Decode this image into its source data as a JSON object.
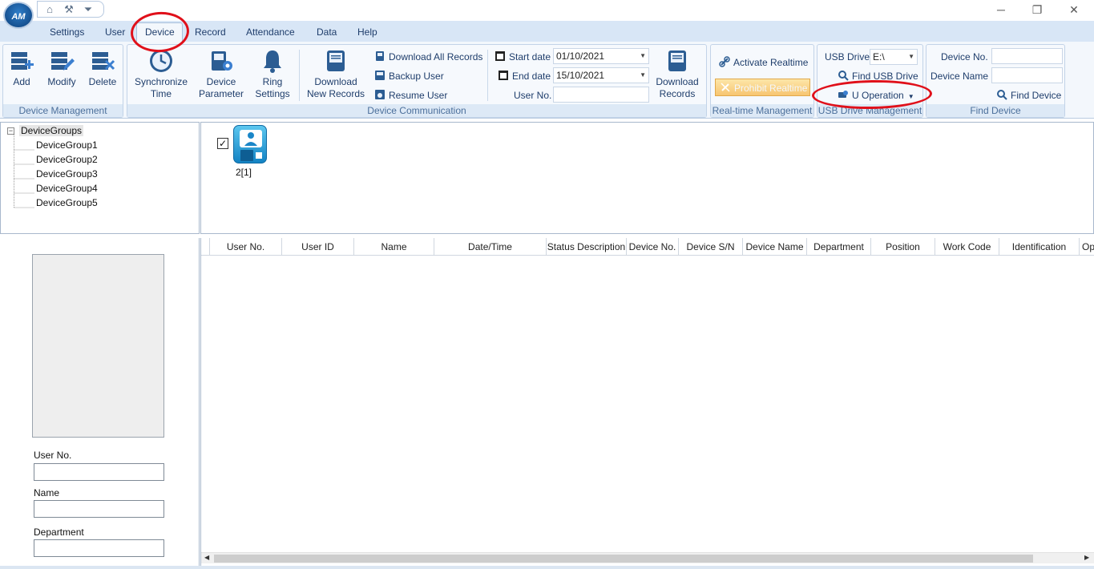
{
  "window": {
    "minimize": "─",
    "restore": "❐",
    "close": "✕"
  },
  "logo_text": "AM",
  "menu": {
    "tabs": [
      "Settings",
      "User",
      "Device",
      "Record",
      "Attendance",
      "Data",
      "Help"
    ],
    "active": "Device"
  },
  "ribbon": {
    "device_management": {
      "caption": "Device Management",
      "add": "Add",
      "modify": "Modify",
      "delete": "Delete"
    },
    "device_communication": {
      "caption": "Device Communication",
      "sync_time": [
        "Synchronize",
        "Time"
      ],
      "device_parameter": [
        "Device",
        "Parameter"
      ],
      "ring_settings": [
        "Ring",
        "Settings"
      ],
      "download_new_records": [
        "Download",
        "New Records"
      ],
      "download_all_records": "Download All Records",
      "backup_user": "Backup User",
      "resume_user": "Resume User",
      "start_date_label": "Start date",
      "start_date_value": "01/10/2021",
      "end_date_label": "End date",
      "end_date_value": "15/10/2021",
      "user_no_label": "User No.",
      "user_no_value": "",
      "download_records": [
        "Download",
        "Records"
      ]
    },
    "realtime": {
      "caption": "Real-time Management",
      "activate": "Activate Realtime",
      "prohibit": "Prohibit Realtime"
    },
    "usb": {
      "caption": "USB Drive Management",
      "drive_label": "USB Drive",
      "drive_value": "E:\\",
      "find_usb": "Find USB Drive",
      "u_operation": "U Operation"
    },
    "find_device": {
      "caption": "Find Device",
      "device_no_label": "Device No.",
      "device_name_label": "Device Name",
      "device_no_value": "",
      "device_name_value": "",
      "find_button": "Find Device"
    }
  },
  "tree": {
    "root": "DeviceGroups",
    "groups": [
      "DeviceGroup1",
      "DeviceGroup2",
      "DeviceGroup3",
      "DeviceGroup4",
      "DeviceGroup5"
    ]
  },
  "devices": [
    {
      "label": "2[1]",
      "checked": true
    }
  ],
  "grid": {
    "columns": [
      "User No.",
      "User ID",
      "Name",
      "Date/Time",
      "Status Description",
      "Device No.",
      "Device S/N",
      "Device Name",
      "Department",
      "Position",
      "Work Code",
      "Identification",
      "Op"
    ],
    "rows": []
  },
  "user_panel": {
    "user_no_label": "User No.",
    "name_label": "Name",
    "department_label": "Department",
    "user_no_value": "",
    "name_value": "",
    "department_value": ""
  },
  "colors": {
    "annotation_ring": "#e0101a",
    "ribbon_bg": "#f3f7fc",
    "tab_bar": "#d8e6f6",
    "prohibit_button": "#f7c571"
  }
}
